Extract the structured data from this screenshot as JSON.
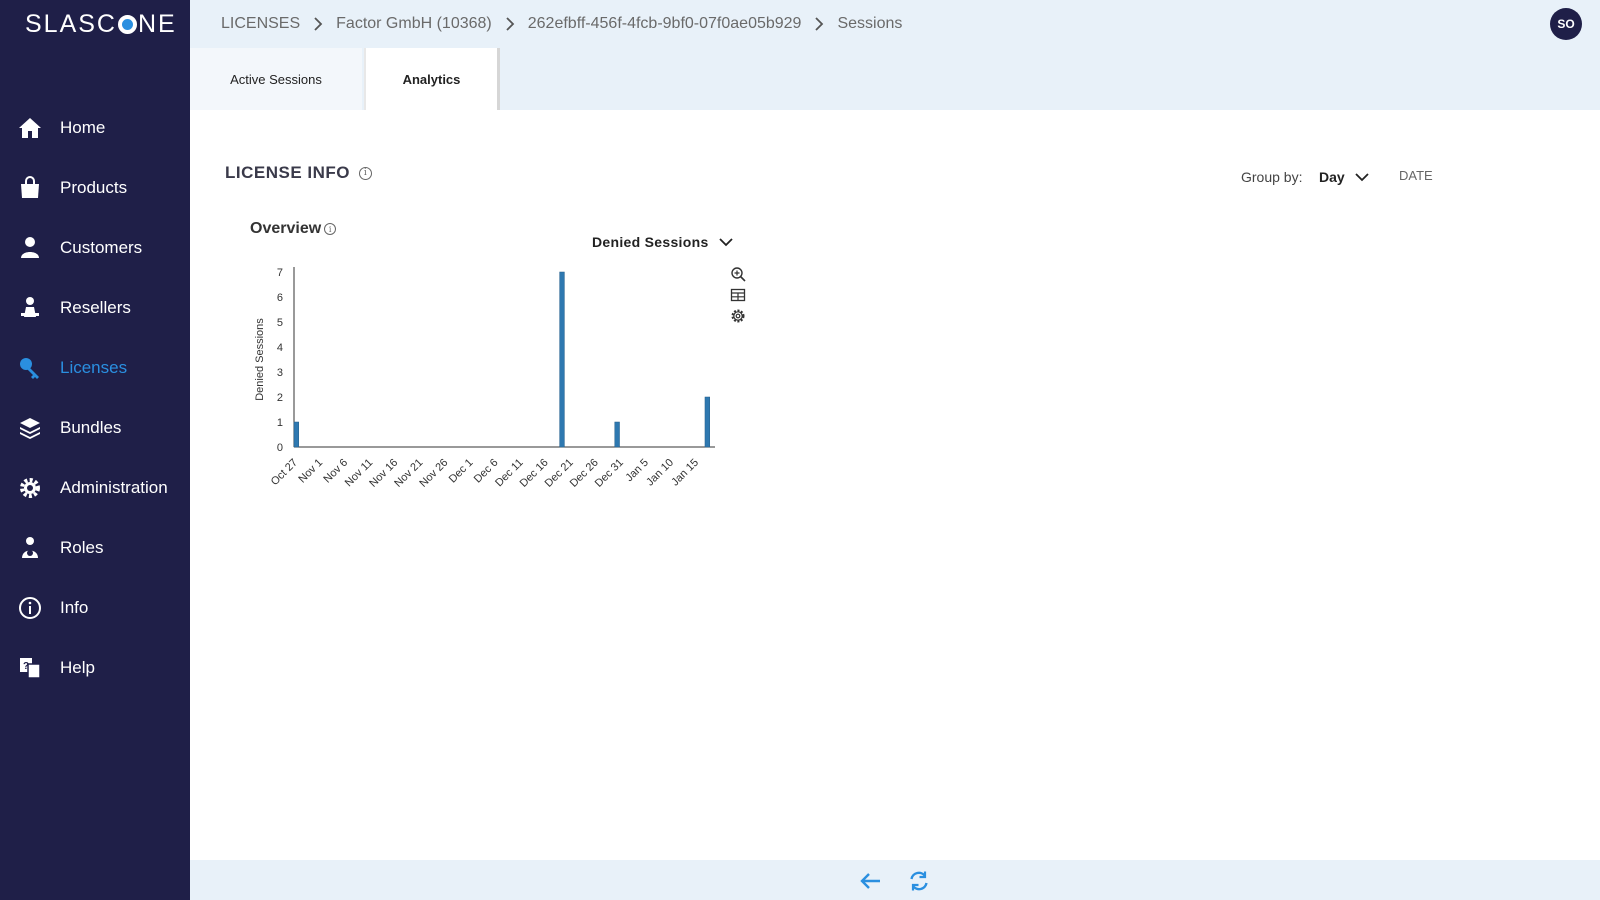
{
  "app": {
    "logo_text_left": "SLASC",
    "logo_text_right": "NE"
  },
  "sidebar": {
    "items": [
      {
        "label": "Home",
        "icon": "home-icon"
      },
      {
        "label": "Products",
        "icon": "shopping-bag-icon"
      },
      {
        "label": "Customers",
        "icon": "user-icon"
      },
      {
        "label": "Resellers",
        "icon": "reseller-icon"
      },
      {
        "label": "Licenses",
        "icon": "key-icon",
        "active": true
      },
      {
        "label": "Bundles",
        "icon": "layers-icon"
      },
      {
        "label": "Administration",
        "icon": "gear-icon"
      },
      {
        "label": "Roles",
        "icon": "role-icon"
      },
      {
        "label": "Info",
        "icon": "info-icon"
      },
      {
        "label": "Help",
        "icon": "help-icon"
      }
    ]
  },
  "header": {
    "breadcrumb": [
      "LICENSES",
      "Factor GmbH (10368)",
      "262efbff-456f-4fcb-9bf0-07f0ae05b929",
      "Sessions"
    ],
    "avatar": "SO"
  },
  "tabs": [
    {
      "label": "Active Sessions",
      "active": false
    },
    {
      "label": "Analytics",
      "active": true
    }
  ],
  "main": {
    "section_title": "LICENSE INFO",
    "group_by_label": "Group by:",
    "group_by_value": "Day",
    "date_button": "DATE",
    "overview_label": "Overview",
    "series_selector": "Denied Sessions"
  },
  "chart_data": {
    "type": "bar",
    "ylabel": "Denied Sessions",
    "xlabel": "",
    "ylim": [
      0,
      7
    ],
    "yticks": [
      0,
      1,
      2,
      3,
      4,
      5,
      6,
      7
    ],
    "x_tick_labels": [
      "Oct 27",
      "Nov 1",
      "Nov 6",
      "Nov 11",
      "Nov 16",
      "Nov 21",
      "Nov 26",
      "Dec 1",
      "Dec 6",
      "Dec 11",
      "Dec 16",
      "Dec 21",
      "Dec 26",
      "Dec 31",
      "Jan 5",
      "Jan 10",
      "Jan 15"
    ],
    "x_range": [
      "2022-10-27",
      "2023-01-19"
    ],
    "points": [
      {
        "date": "2022-10-27",
        "value": 1
      },
      {
        "date": "2022-12-19",
        "value": 7
      },
      {
        "date": "2022-12-30",
        "value": 1
      },
      {
        "date": "2023-01-17",
        "value": 2
      }
    ],
    "color": "#2e78b0"
  },
  "colors": {
    "sidebar_bg": "#1f1f48",
    "accent": "#2a8fe0",
    "header_bg": "#e8f1f9",
    "bar": "#2e78b0"
  }
}
